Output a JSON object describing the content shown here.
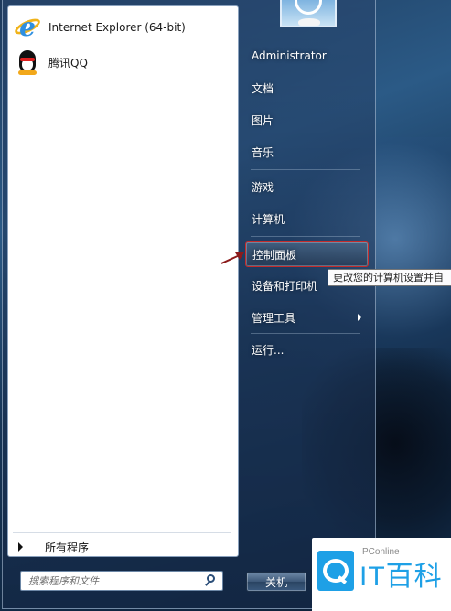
{
  "programs": [
    {
      "label": "Internet Explorer (64-bit)",
      "icon": "internet-explorer-icon"
    },
    {
      "label": "腾讯QQ",
      "icon": "qq-penguin-icon"
    }
  ],
  "all_programs_label": "所有程序",
  "search": {
    "placeholder": "搜索程序和文件"
  },
  "right_pane": {
    "items": [
      {
        "label": "Administrator"
      },
      {
        "label": "文档"
      },
      {
        "label": "图片"
      },
      {
        "label": "音乐"
      },
      {
        "label": "游戏"
      },
      {
        "label": "计算机"
      },
      {
        "label": "控制面板",
        "highlighted": true
      },
      {
        "label": "设备和打印机"
      },
      {
        "label": "管理工具",
        "has_submenu": true
      },
      {
        "label": "运行..."
      }
    ]
  },
  "tooltip": "更改您的计算机设置并自",
  "shutdown_label": "关机",
  "watermark": {
    "small": "PConline",
    "big": "IT百科"
  },
  "colors": {
    "highlight_border": "#c52b2b",
    "annotation_arrow": "#8b1a1a",
    "watermark_blue": "#1ea0e6"
  }
}
